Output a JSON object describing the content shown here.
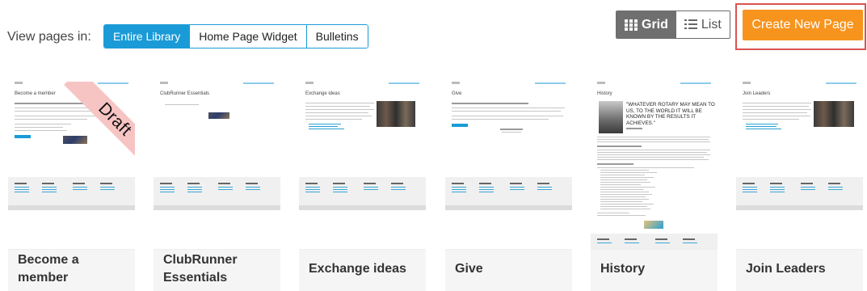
{
  "filter": {
    "label": "View pages in:",
    "options": [
      {
        "label": "Entire Library",
        "active": true
      },
      {
        "label": "Home Page Widget",
        "active": false
      },
      {
        "label": "Bulletins",
        "active": false
      }
    ]
  },
  "view_toggle": {
    "grid_label": "Grid",
    "list_label": "List",
    "active": "grid"
  },
  "create_button": {
    "label": "Create New Page"
  },
  "badge": {
    "draft": "Draft"
  },
  "pages": [
    {
      "title": "Become a member",
      "thumb_title": "Become a member",
      "draft": true
    },
    {
      "title": "ClubRunner Essentials",
      "thumb_title": "ClubRunner Essentials",
      "draft": false
    },
    {
      "title": "Exchange ideas",
      "thumb_title": "Exchange ideas",
      "draft": false
    },
    {
      "title": "Give",
      "thumb_title": "Give",
      "draft": false
    },
    {
      "title": "History",
      "thumb_title": "History",
      "draft": false,
      "quote": "\"WHATEVER ROTARY MAY MEAN TO US, TO THE WORLD IT WILL BE KNOWN BY THE RESULTS IT ACHIEVES.\""
    },
    {
      "title": "Join Leaders",
      "thumb_title": "Join Leaders",
      "draft": false
    }
  ],
  "colors": {
    "accent": "#1a9bd7",
    "create": "#f7941d",
    "highlight": "#d9534f",
    "draft": "#f7c4c4"
  }
}
